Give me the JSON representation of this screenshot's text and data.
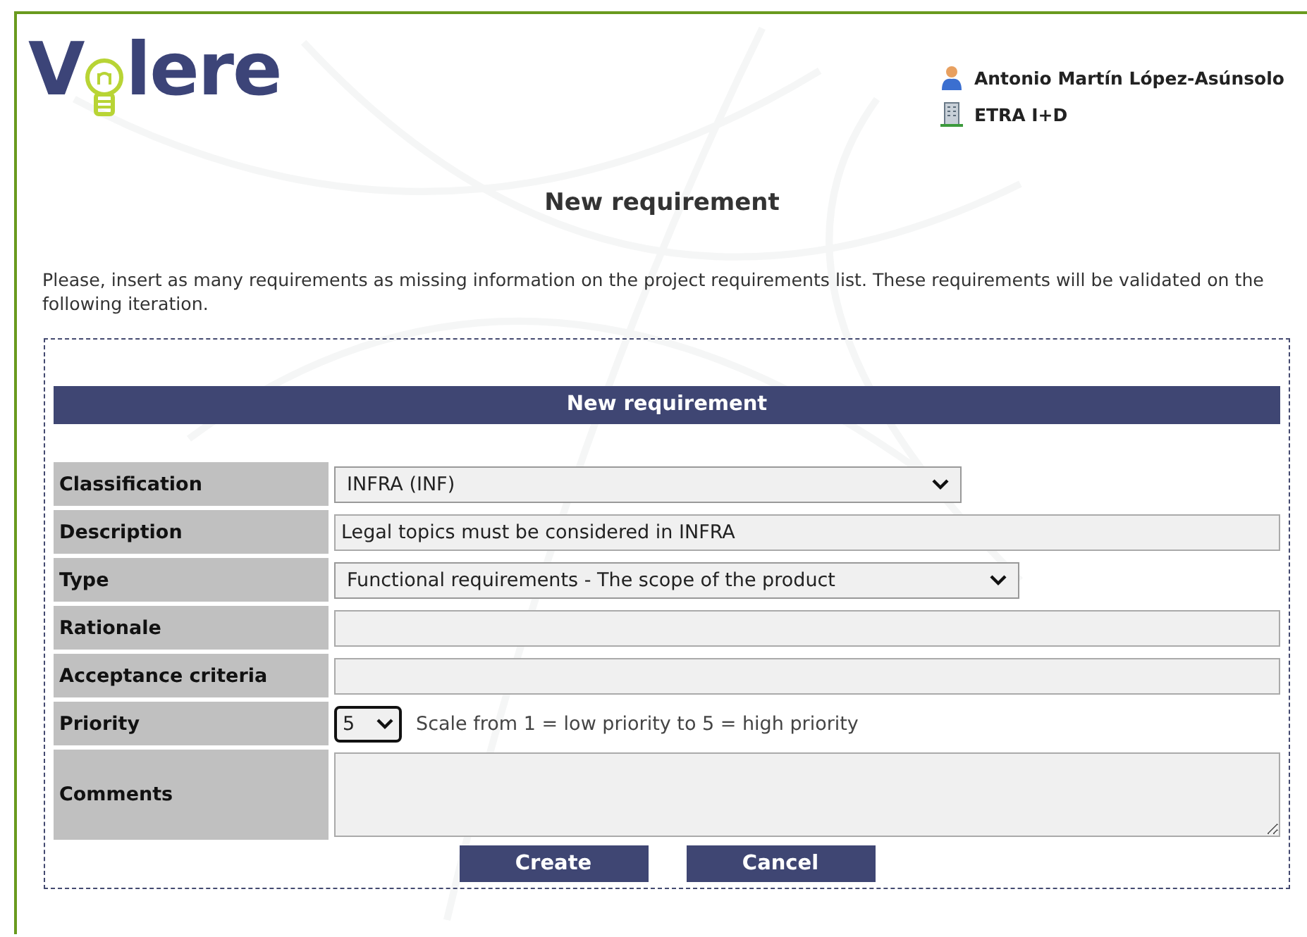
{
  "logo": {
    "before": "V",
    "after": "lere"
  },
  "user": {
    "name": "Antonio Martín López-Asúnsolo",
    "organization": "ETRA I+D"
  },
  "page_title": "New requirement",
  "intro": "Please, insert as many requirements as missing information on the project requirements list. These requirements will be validated on the following iteration.",
  "form": {
    "title": "New requirement",
    "fields": [
      {
        "label": "Classification",
        "kind": "select",
        "value": "INFRA (INF)"
      },
      {
        "label": "Description",
        "kind": "text",
        "value": "Legal topics must be considered in INFRA"
      },
      {
        "label": "Type",
        "kind": "select",
        "value": "Functional requirements - The scope of the product"
      },
      {
        "label": "Rationale",
        "kind": "text"
      },
      {
        "label": "Acceptance criteria",
        "kind": "text"
      },
      {
        "label": "Priority",
        "kind": "small-select",
        "value": "5",
        "note": "Scale from 1 = low priority to 5 = high priority"
      },
      {
        "label": "Comments",
        "kind": "textarea"
      }
    ],
    "buttons": [
      "Create",
      "Cancel"
    ]
  }
}
